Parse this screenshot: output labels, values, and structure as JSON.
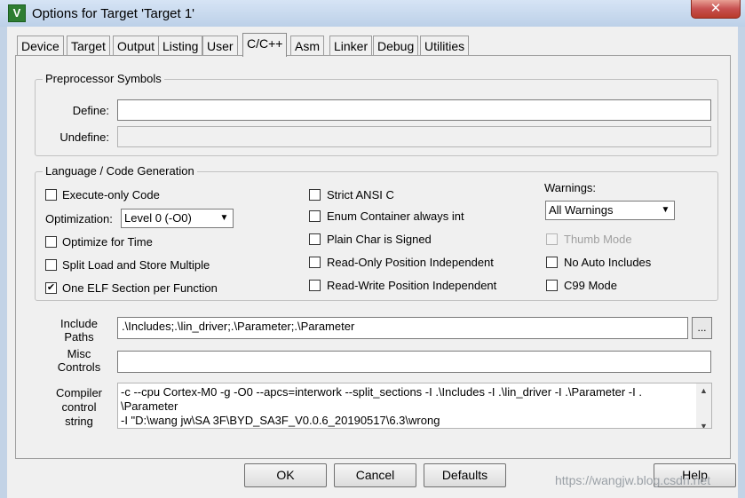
{
  "window": {
    "title": "Options for Target 'Target 1'",
    "close_label": "✕",
    "icon_letter": "V"
  },
  "tabs": [
    {
      "label": "Device"
    },
    {
      "label": "Target"
    },
    {
      "label": "Output"
    },
    {
      "label": "Listing"
    },
    {
      "label": "User"
    },
    {
      "label": "C/C++"
    },
    {
      "label": "Asm"
    },
    {
      "label": "Linker"
    },
    {
      "label": "Debug"
    },
    {
      "label": "Utilities"
    }
  ],
  "preprocessor": {
    "group_label": "Preprocessor Symbols",
    "define_label": "Define:",
    "define_value": "",
    "undefine_label": "Undefine:",
    "undefine_value": ""
  },
  "language": {
    "group_label": "Language / Code Generation",
    "execute_only": {
      "label": "Execute-only Code",
      "checked": false
    },
    "optimization_label": "Optimization:",
    "optimization_value": "Level 0 (-O0)",
    "optimize_time": {
      "label": "Optimize for Time",
      "checked": false
    },
    "split_load": {
      "label": "Split Load and Store Multiple",
      "checked": false
    },
    "one_elf": {
      "label": "One ELF Section per Function",
      "checked": true
    },
    "strict_ansi": {
      "label": "Strict ANSI C",
      "checked": false
    },
    "enum_container": {
      "label": "Enum Container always int",
      "checked": false
    },
    "plain_char": {
      "label": "Plain Char is Signed",
      "checked": false
    },
    "ro_position": {
      "label": "Read-Only Position Independent",
      "checked": false
    },
    "rw_position": {
      "label": "Read-Write Position Independent",
      "checked": false
    },
    "warnings_label": "Warnings:",
    "warnings_value": "All Warnings",
    "thumb_mode": {
      "label": "Thumb Mode",
      "checked": false
    },
    "no_auto_includes": {
      "label": "No Auto Includes",
      "checked": false
    },
    "c99_mode": {
      "label": "C99 Mode",
      "checked": false
    }
  },
  "include": {
    "label_line1": "Include",
    "label_line2": "Paths",
    "value": ".\\Includes;.\\lin_driver;.\\Parameter;.\\Parameter",
    "browse_label": "..."
  },
  "misc": {
    "label_line1": "Misc",
    "label_line2": "Controls",
    "value": ""
  },
  "compiler": {
    "label_line1": "Compiler",
    "label_line2": "control",
    "label_line3": "string",
    "line1": "-c --cpu Cortex-M0 -g -O0 --apcs=interwork --split_sections -I .\\Includes -I .\\lin_driver -I .\\Parameter -I .",
    "line2": "\\Parameter",
    "line3": "-I \"D:\\wang jw\\SA 3F\\BYD_SA3F_V0.0.6_20190517\\6.3\\wrong"
  },
  "buttons": {
    "ok": "OK",
    "cancel": "Cancel",
    "defaults": "Defaults",
    "help": "Help"
  },
  "watermark": "https://wangjw.blog.csdn.net"
}
